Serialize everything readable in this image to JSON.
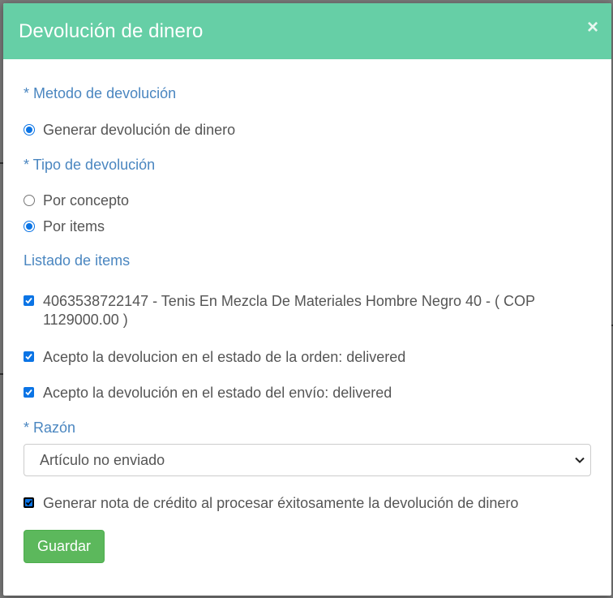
{
  "modal": {
    "title": "Devolución de dinero",
    "close_label": "×"
  },
  "form": {
    "metodo_label": "* Metodo de devolución",
    "metodo_options": [
      {
        "label": "Generar devolución de dinero",
        "checked": true
      }
    ],
    "tipo_label": "* Tipo de devolución",
    "tipo_options": [
      {
        "label": "Por concepto",
        "checked": false
      },
      {
        "label": "Por items",
        "checked": true
      }
    ],
    "items_label": "Listado de items",
    "items": [
      {
        "label": "4063538722147 - Tenis En Mezcla De Materiales Hombre Negro 40 - ( COP 1129000.00 )",
        "checked": true
      },
      {
        "label": "Acepto la devolucion en el estado de la orden: delivered",
        "checked": true
      },
      {
        "label": "Acepto la devolución en el estado del envío: delivered",
        "checked": true
      }
    ],
    "razon_label": "* Razón",
    "razon_selected": "Artículo no enviado",
    "credit_note_label": "Generar nota de crédito al procesar éxitosamente la devolución de dinero",
    "credit_note_checked": true,
    "save_label": "Guardar"
  },
  "colors": {
    "header_bg": "#66cfa6",
    "label_blue": "#4a86c0",
    "accent": "#0b74e5",
    "save_green": "#5cb85c"
  }
}
